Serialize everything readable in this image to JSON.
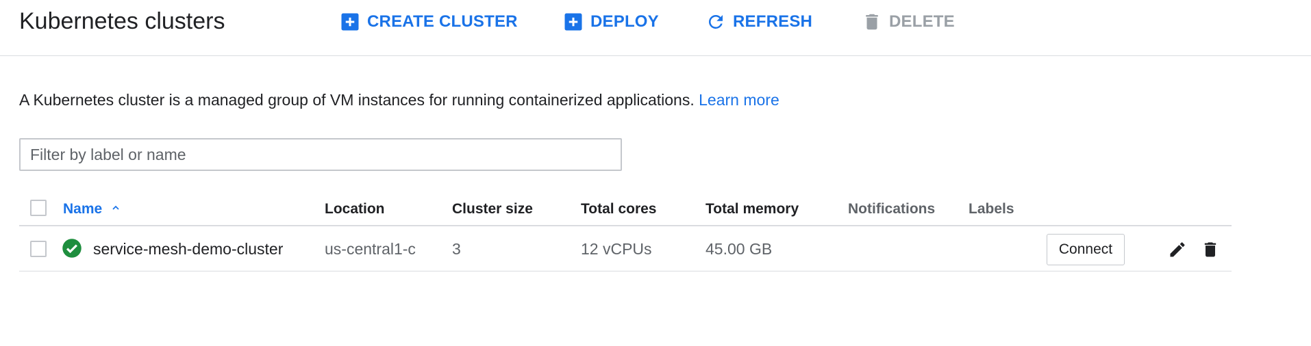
{
  "header": {
    "title": "Kubernetes clusters",
    "actions": {
      "create": "CREATE CLUSTER",
      "deploy": "DEPLOY",
      "refresh": "REFRESH",
      "delete": "DELETE"
    }
  },
  "description": {
    "text": "A Kubernetes cluster is a managed group of VM instances for running containerized applications.",
    "link": "Learn more"
  },
  "filter": {
    "placeholder": "Filter by label or name",
    "value": ""
  },
  "table": {
    "columns": {
      "name": "Name",
      "location": "Location",
      "cluster_size": "Cluster size",
      "total_cores": "Total cores",
      "total_memory": "Total memory",
      "notifications": "Notifications",
      "labels": "Labels"
    },
    "sort": {
      "column": "name",
      "direction": "ascending"
    },
    "rows": [
      {
        "status": "ok",
        "name": "service-mesh-demo-cluster",
        "location": "us-central1-c",
        "cluster_size": "3",
        "total_cores": "12 vCPUs",
        "total_memory": "45.00 GB",
        "notifications": "",
        "labels": "",
        "connect_label": "Connect"
      }
    ]
  },
  "colors": {
    "accent": "#1a73e8",
    "disabled": "#9aa0a6",
    "status_ok": "#1e8e3e",
    "border": "#dadce0"
  },
  "icons": {
    "create": "add-box-icon",
    "deploy": "add-box-icon",
    "refresh": "refresh-icon",
    "delete": "trash-icon",
    "sort": "chevron-up-icon",
    "status": "check-circle-icon",
    "edit": "pencil-icon",
    "remove": "trash-icon"
  }
}
